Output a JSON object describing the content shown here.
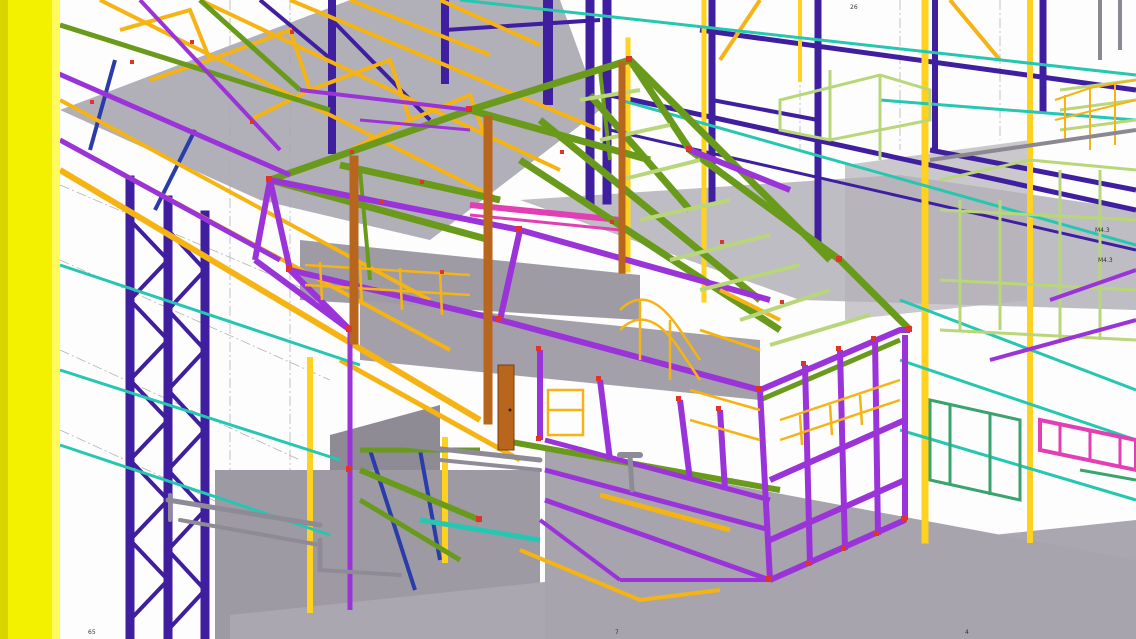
{
  "viewport": {
    "grid_labels": [
      "26",
      "M4.3",
      "M4.3",
      "4",
      "7",
      "65"
    ]
  },
  "colors": {
    "background": "#fdfdfd",
    "yellow": "#ffd21f",
    "orange_yellow": "#f5b414",
    "indigo": "#3f1fa0",
    "navy": "#2a3ca8",
    "violet": "#9b34d8",
    "green": "#6a9a1c",
    "lime": "#b9d77a",
    "cyan": "#26c7b0",
    "magenta": "#e23fb4",
    "grey_slab": "#a09da7",
    "grey_dark": "#8b8892",
    "brown": "#b8651e",
    "red_conn": "#e0342a",
    "edge_yellow": "#f4f100"
  }
}
